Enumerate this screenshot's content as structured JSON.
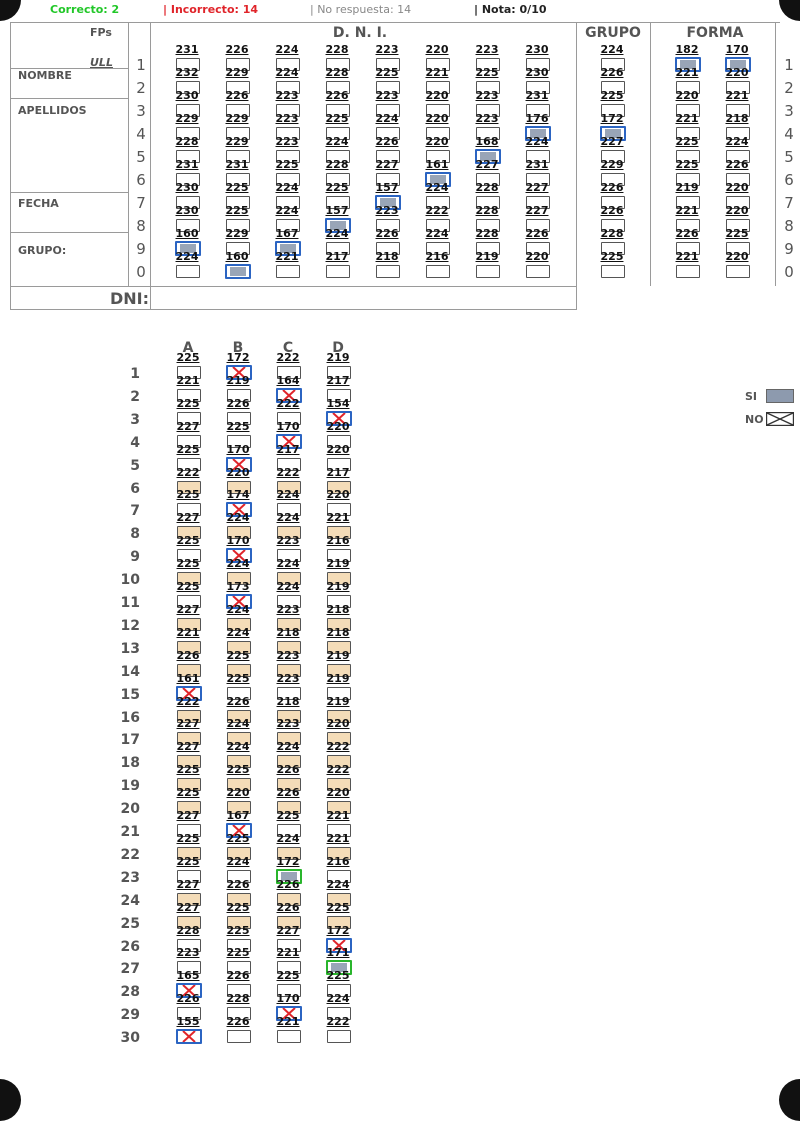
{
  "status": {
    "correct": "Correcto: 2",
    "incorrect": "| Incorrecto: 14",
    "no_answer": "| No respuesta: 14",
    "grade": "| Nota: 0/10"
  },
  "header": {
    "fps": "FPs",
    "ull": "ULL",
    "nombre": "NOMBRE",
    "apellidos": "APELLIDOS",
    "fecha": "FECHA",
    "grupo_label": "GRUPO:",
    "dni_title": "D. N. I.",
    "grupo_title": "GRUPO",
    "forma_title": "FORMA",
    "dni_label": "DNI:",
    "row_labels": [
      "1",
      "2",
      "3",
      "4",
      "5",
      "6",
      "7",
      "8",
      "9",
      "0"
    ],
    "dni": [
      {
        "n": [
          "231",
          "232",
          "230",
          "229",
          "228",
          "231",
          "230",
          "230",
          "160",
          "224"
        ],
        "s": [
          0,
          0,
          0,
          0,
          0,
          0,
          0,
          0,
          9,
          0
        ]
      },
      {
        "n": [
          "226",
          "229",
          "226",
          "229",
          "229",
          "231",
          "225",
          "225",
          "229",
          "160"
        ],
        "s": [
          0,
          0,
          0,
          0,
          0,
          0,
          0,
          0,
          0,
          10
        ]
      },
      {
        "n": [
          "224",
          "224",
          "223",
          "223",
          "223",
          "225",
          "224",
          "224",
          "167",
          "221"
        ],
        "s": [
          0,
          0,
          0,
          0,
          0,
          0,
          0,
          0,
          9,
          0
        ]
      },
      {
        "n": [
          "228",
          "228",
          "226",
          "225",
          "224",
          "228",
          "225",
          "157",
          "224",
          "217"
        ],
        "s": [
          0,
          0,
          0,
          0,
          0,
          0,
          0,
          8,
          0,
          0
        ]
      },
      {
        "n": [
          "223",
          "225",
          "223",
          "224",
          "226",
          "227",
          "157",
          "223",
          "226",
          "218"
        ],
        "s": [
          0,
          0,
          0,
          0,
          0,
          0,
          7,
          0,
          0,
          0
        ]
      },
      {
        "n": [
          "220",
          "221",
          "220",
          "220",
          "220",
          "161",
          "224",
          "222",
          "224",
          "216"
        ],
        "s": [
          0,
          0,
          0,
          0,
          0,
          6,
          0,
          0,
          0,
          0
        ]
      },
      {
        "n": [
          "223",
          "225",
          "223",
          "223",
          "168",
          "227",
          "228",
          "228",
          "228",
          "219"
        ],
        "s": [
          0,
          0,
          0,
          0,
          5,
          0,
          0,
          0,
          0,
          0
        ]
      },
      {
        "n": [
          "230",
          "230",
          "231",
          "176",
          "224",
          "231",
          "227",
          "227",
          "226",
          "220"
        ],
        "s": [
          0,
          0,
          0,
          4,
          0,
          0,
          0,
          0,
          0,
          0
        ]
      }
    ],
    "grupo": [
      {
        "n": [
          "224",
          "226",
          "225",
          "172",
          "227",
          "229",
          "226",
          "226",
          "228",
          "225"
        ],
        "s": [
          0,
          0,
          0,
          4,
          0,
          0,
          0,
          0,
          0,
          0
        ]
      }
    ],
    "forma": [
      {
        "n": [
          "182",
          "221",
          "220",
          "221",
          "225",
          "225",
          "219",
          "221",
          "226",
          "221"
        ],
        "s": [
          1,
          0,
          0,
          0,
          0,
          0,
          0,
          0,
          0,
          0
        ]
      },
      {
        "n": [
          "170",
          "220",
          "221",
          "218",
          "224",
          "226",
          "220",
          "220",
          "225",
          "220"
        ],
        "s": [
          1,
          0,
          0,
          0,
          0,
          0,
          0,
          0,
          0,
          0
        ]
      }
    ]
  },
  "answers": {
    "columns": [
      "A",
      "B",
      "C",
      "D"
    ],
    "rows": [
      {
        "q": "1",
        "n": [
          "225",
          "172",
          "222",
          "219"
        ],
        "m": [
          "",
          "bx",
          "",
          ""
        ],
        "sh": false
      },
      {
        "q": "2",
        "n": [
          "221",
          "219",
          "164",
          "217"
        ],
        "m": [
          "",
          "",
          "bx",
          ""
        ],
        "sh": false
      },
      {
        "q": "3",
        "n": [
          "225",
          "226",
          "222",
          "154"
        ],
        "m": [
          "",
          "",
          "",
          "bx"
        ],
        "sh": false
      },
      {
        "q": "4",
        "n": [
          "227",
          "225",
          "170",
          "220"
        ],
        "m": [
          "",
          "",
          "bx",
          ""
        ],
        "sh": false
      },
      {
        "q": "5",
        "n": [
          "225",
          "170",
          "217",
          "220"
        ],
        "m": [
          "",
          "bx",
          "",
          ""
        ],
        "sh": false
      },
      {
        "q": "6",
        "n": [
          "222",
          "220",
          "222",
          "217"
        ],
        "m": [
          "",
          "",
          "",
          ""
        ],
        "sh": true
      },
      {
        "q": "7",
        "n": [
          "225",
          "174",
          "224",
          "220"
        ],
        "m": [
          "",
          "bx",
          "",
          ""
        ],
        "sh": false
      },
      {
        "q": "8",
        "n": [
          "227",
          "224",
          "224",
          "221"
        ],
        "m": [
          "",
          "",
          "",
          ""
        ],
        "sh": true
      },
      {
        "q": "9",
        "n": [
          "225",
          "170",
          "223",
          "216"
        ],
        "m": [
          "",
          "bx",
          "",
          ""
        ],
        "sh": false
      },
      {
        "q": "10",
        "n": [
          "225",
          "224",
          "224",
          "219"
        ],
        "m": [
          "",
          "",
          "",
          ""
        ],
        "sh": true
      },
      {
        "q": "11",
        "n": [
          "225",
          "173",
          "224",
          "219"
        ],
        "m": [
          "",
          "bx",
          "",
          ""
        ],
        "sh": false
      },
      {
        "q": "12",
        "n": [
          "227",
          "224",
          "223",
          "218"
        ],
        "m": [
          "",
          "",
          "",
          ""
        ],
        "sh": true
      },
      {
        "q": "13",
        "n": [
          "221",
          "224",
          "218",
          "218"
        ],
        "m": [
          "",
          "",
          "",
          ""
        ],
        "sh": true
      },
      {
        "q": "14",
        "n": [
          "226",
          "225",
          "223",
          "219"
        ],
        "m": [
          "",
          "",
          "",
          ""
        ],
        "sh": true
      },
      {
        "q": "15",
        "n": [
          "161",
          "225",
          "223",
          "219"
        ],
        "m": [
          "bx",
          "",
          "",
          ""
        ],
        "sh": false
      },
      {
        "q": "16",
        "n": [
          "222",
          "226",
          "218",
          "219"
        ],
        "m": [
          "",
          "",
          "",
          ""
        ],
        "sh": true
      },
      {
        "q": "17",
        "n": [
          "227",
          "224",
          "223",
          "220"
        ],
        "m": [
          "",
          "",
          "",
          ""
        ],
        "sh": true
      },
      {
        "q": "18",
        "n": [
          "227",
          "224",
          "224",
          "222"
        ],
        "m": [
          "",
          "",
          "",
          ""
        ],
        "sh": true
      },
      {
        "q": "19",
        "n": [
          "225",
          "225",
          "226",
          "222"
        ],
        "m": [
          "",
          "",
          "",
          ""
        ],
        "sh": true
      },
      {
        "q": "20",
        "n": [
          "225",
          "220",
          "226",
          "220"
        ],
        "m": [
          "",
          "",
          "",
          ""
        ],
        "sh": true
      },
      {
        "q": "21",
        "n": [
          "227",
          "167",
          "225",
          "221"
        ],
        "m": [
          "",
          "bx",
          "",
          ""
        ],
        "sh": false
      },
      {
        "q": "22",
        "n": [
          "225",
          "225",
          "224",
          "221"
        ],
        "m": [
          "",
          "",
          "",
          ""
        ],
        "sh": true
      },
      {
        "q": "23",
        "n": [
          "225",
          "224",
          "172",
          "216"
        ],
        "m": [
          "",
          "",
          "gf",
          ""
        ],
        "sh": false
      },
      {
        "q": "24",
        "n": [
          "227",
          "226",
          "226",
          "224"
        ],
        "m": [
          "",
          "",
          "",
          ""
        ],
        "sh": true
      },
      {
        "q": "25",
        "n": [
          "227",
          "225",
          "226",
          "225"
        ],
        "m": [
          "",
          "",
          "",
          ""
        ],
        "sh": true
      },
      {
        "q": "26",
        "n": [
          "228",
          "225",
          "227",
          "172"
        ],
        "m": [
          "",
          "",
          "",
          "bx"
        ],
        "sh": false
      },
      {
        "q": "27",
        "n": [
          "223",
          "225",
          "221",
          "171"
        ],
        "m": [
          "",
          "",
          "",
          "gf"
        ],
        "sh": false
      },
      {
        "q": "28",
        "n": [
          "165",
          "226",
          "225",
          "225"
        ],
        "m": [
          "bx",
          "",
          "",
          ""
        ],
        "sh": false
      },
      {
        "q": "29",
        "n": [
          "226",
          "228",
          "170",
          "224"
        ],
        "m": [
          "",
          "",
          "bx",
          ""
        ],
        "sh": false
      },
      {
        "q": "30",
        "n": [
          "155",
          "226",
          "221",
          "222"
        ],
        "m": [
          "bx",
          "",
          "",
          ""
        ],
        "sh": false
      }
    ]
  },
  "legend": {
    "si": "SI",
    "no": "NO"
  },
  "colors": {
    "correct": "#21c728",
    "incorrect": "#e0242a",
    "status_gray": "#888888",
    "mark_blue": "#2b64c2",
    "mark_green": "#29b52c",
    "shade": "#f4dcb8",
    "fill_gray": "#8795aa"
  }
}
